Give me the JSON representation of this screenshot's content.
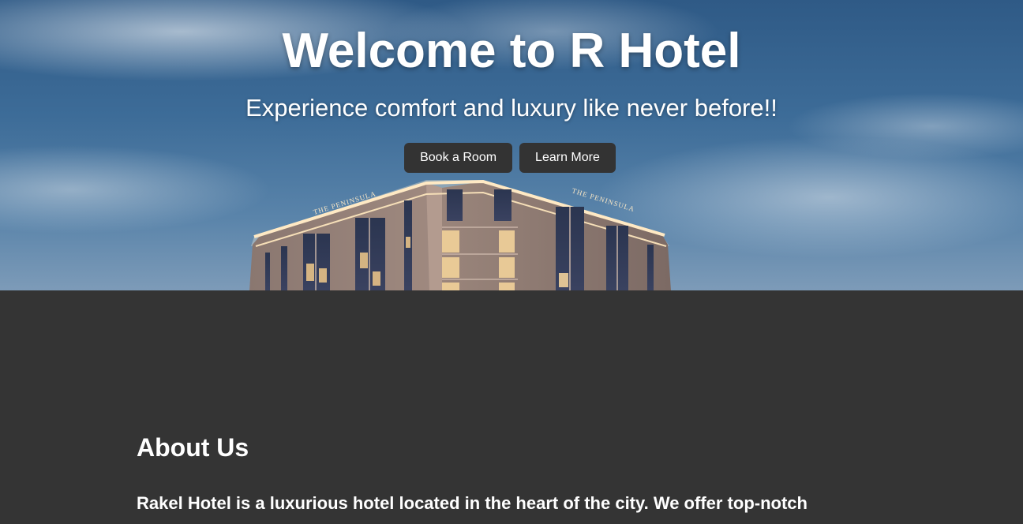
{
  "hero": {
    "title": "Welcome to R Hotel",
    "subtitle": "Experience comfort and luxury like never before!!",
    "buttons": {
      "book_label": "Book a Room",
      "learn_label": "Learn More"
    },
    "building_sign": "THE PENINSULA"
  },
  "about": {
    "heading": "About Us",
    "text": "Rakel Hotel is a luxurious hotel located in the heart of the city. We offer top-notch"
  },
  "colors": {
    "page_background": "#343434",
    "button_background": "#333333",
    "text": "#ffffff",
    "sky": "#3d6c98"
  }
}
